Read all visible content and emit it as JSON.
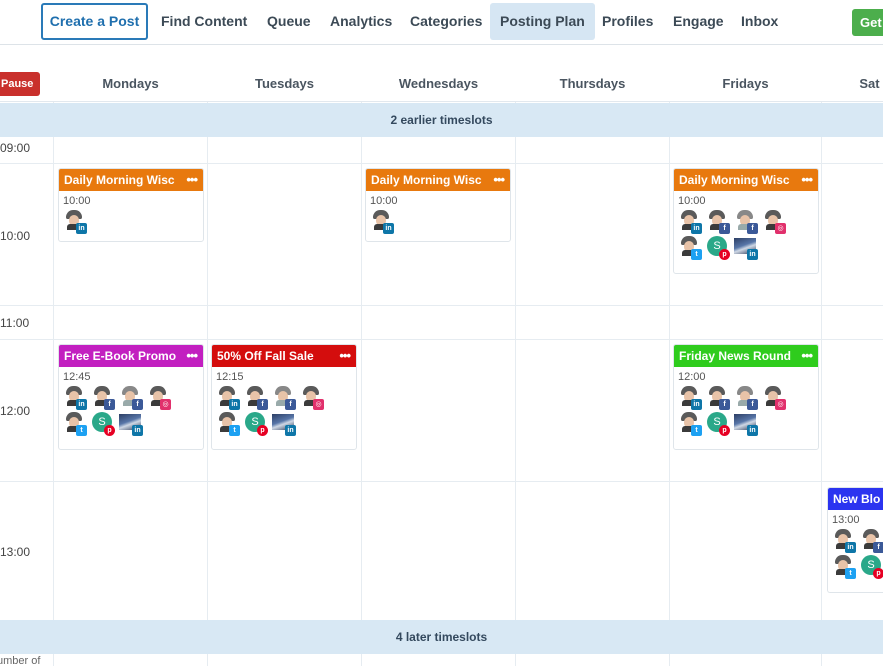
{
  "nav": {
    "create": "Create a Post",
    "items": [
      "Find Content",
      "Queue",
      "Analytics",
      "Categories",
      "Posting Plan",
      "Profiles",
      "Engage",
      "Inbox"
    ],
    "get": "Get"
  },
  "pause": "Pause",
  "days": [
    "Mondays",
    "Tuesdays",
    "Wednesdays",
    "Thursdays",
    "Fridays",
    "Sat"
  ],
  "bands": {
    "earlier": "2 earlier timeslots",
    "later": "4 later timeslots"
  },
  "times": [
    "09:00",
    "10:00",
    "11:00",
    "12:00",
    "13:00"
  ],
  "footer": "umber of",
  "colors": {
    "orange": "#e8790e",
    "magenta": "#c21fc0",
    "red": "#d40d0d",
    "green": "#2fcc1d",
    "blue": "#2b34f0"
  },
  "cards": {
    "mon_morning": {
      "title": "Daily Morning Wisc",
      "time": "10:00",
      "more": "•••"
    },
    "wed_morning": {
      "title": "Daily Morning Wisc",
      "time": "10:00",
      "more": "•••"
    },
    "fri_morning": {
      "title": "Daily Morning Wisc",
      "time": "10:00",
      "more": "•••"
    },
    "mon_ebook": {
      "title": "Free E-Book Promo",
      "time": "12:45",
      "more": "•••"
    },
    "tue_sale": {
      "title": "50% Off Fall Sale",
      "time": "12:15",
      "more": "•••"
    },
    "fri_news": {
      "title": "Friday News Round",
      "time": "12:00",
      "more": "•••"
    },
    "sat_blog": {
      "title": "New Blo",
      "time": "13:00"
    }
  },
  "avatar_circle_letter": "S",
  "icons": {
    "linkedin": "linkedin-icon",
    "facebook": "facebook-icon",
    "instagram": "instagram-icon",
    "twitter": "twitter-icon",
    "pinterest": "pinterest-icon"
  }
}
